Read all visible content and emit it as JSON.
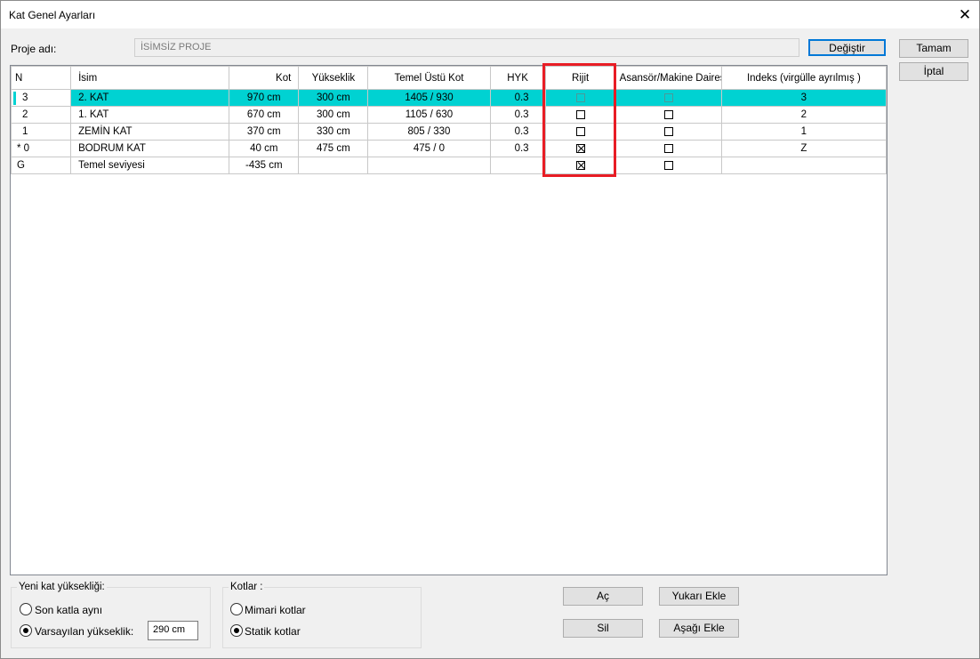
{
  "window": {
    "title": "Kat Genel Ayarları",
    "close_glyph": "✕"
  },
  "project": {
    "label": "Proje adı:",
    "value": "İSİMSİZ PROJE",
    "change_button": "Değiştir"
  },
  "actions": {
    "ok": "Tamam",
    "cancel": "İptal"
  },
  "grid": {
    "columns": [
      "N",
      "İsim",
      "Kot",
      "Yükseklik",
      "Temel Üstü Kot",
      "HYK",
      "Rijit",
      "Asansör/Makine Dairesi",
      "Indeks (virgülle ayrılmış )"
    ],
    "rows": [
      {
        "n": "3",
        "name": "2. KAT",
        "kot": "970 cm",
        "height": "300 cm",
        "temel": "1405 / 930",
        "hyk": "0.3",
        "rijit": false,
        "elevator": false,
        "index": "3",
        "selected": true
      },
      {
        "n": "2",
        "name": "1. KAT",
        "kot": "670 cm",
        "height": "300 cm",
        "temel": "1105 / 630",
        "hyk": "0.3",
        "rijit": false,
        "elevator": false,
        "index": "2",
        "selected": false
      },
      {
        "n": "1",
        "name": "ZEMİN KAT",
        "kot": "370 cm",
        "height": "330 cm",
        "temel": "805 / 330",
        "hyk": "0.3",
        "rijit": false,
        "elevator": false,
        "index": "1",
        "selected": false
      },
      {
        "n": "* 0",
        "name": "BODRUM KAT",
        "kot": "40 cm",
        "height": "475 cm",
        "temel": "475 / 0",
        "hyk": "0.3",
        "rijit": true,
        "elevator": false,
        "index": "Z",
        "selected": false
      },
      {
        "n": "G",
        "name": "Temel seviyesi",
        "kot": "-435 cm",
        "height": "",
        "temel": "",
        "hyk": "",
        "rijit": true,
        "elevator": false,
        "index": "",
        "selected": false
      }
    ]
  },
  "new_floor": {
    "title": "Yeni kat yüksekliği:",
    "option_same": "Son katla aynı",
    "option_default": "Varsayılan yükseklik:",
    "default_value": "290 cm",
    "selected": "default"
  },
  "levels": {
    "title": "Kotlar :",
    "option_arch": "Mimari kotlar",
    "option_static": "Statik kotlar",
    "selected": "static"
  },
  "buttons": {
    "open": "Aç",
    "delete": "Sil",
    "add_above": "Yukarı Ekle",
    "add_below": "Aşağı Ekle"
  },
  "colors": {
    "selection": "#00d2d2",
    "highlight": "#e81d25",
    "default_border": "#0078d7"
  }
}
